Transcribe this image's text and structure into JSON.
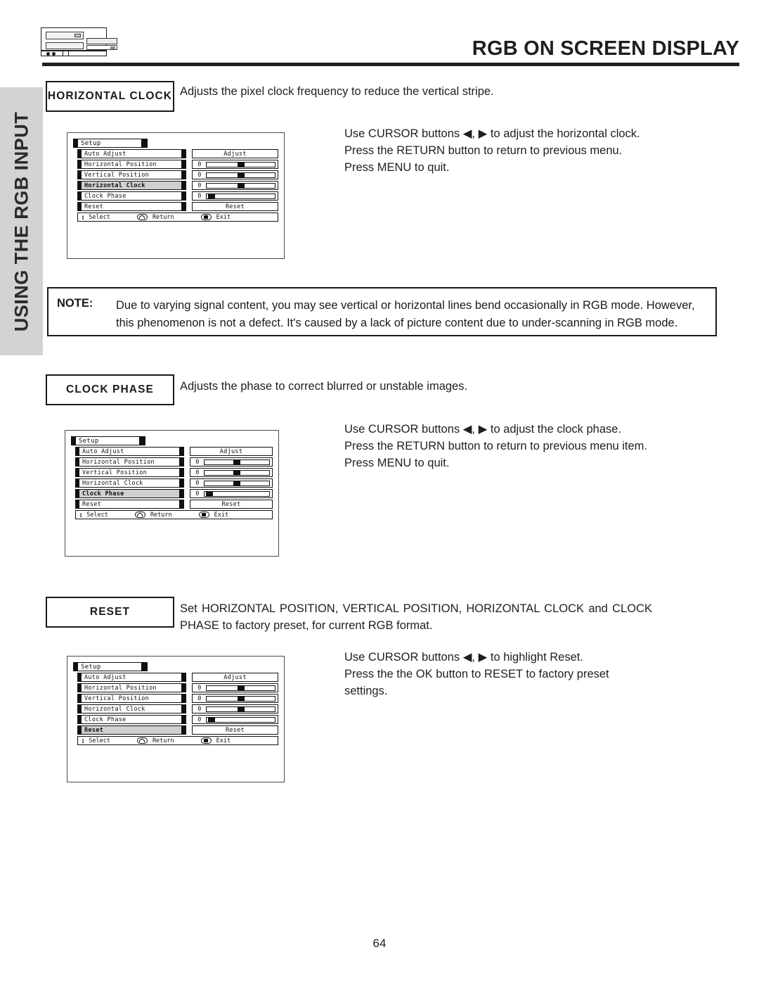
{
  "header": {
    "title": "RGB ON SCREEN DISPLAY",
    "logo_icon": "tv-equipment-icon"
  },
  "sidebar": {
    "label": "USING THE RGB INPUT"
  },
  "page": {
    "number": "64"
  },
  "note": {
    "label": "NOTE:",
    "text": "Due to varying signal content, you may see vertical or horizontal lines bend occasionally in RGB mode.  However, this phenomenon is not a defect.  It's caused by a lack of picture content due to under-scanning in RGB mode."
  },
  "sections": [
    {
      "label": "HORIZONTAL CLOCK",
      "description": "Adjusts the pixel clock frequency to reduce the vertical stripe.",
      "instructions": "Use CURSOR buttons ◀, ▶ to adjust the horizontal clock.\nPress the RETURN button to return to previous menu.\nPress MENU to quit.",
      "instruction_lines": [
        "Use CURSOR buttons ◀, ▶ to adjust the horizontal clock.",
        "Press the RETURN button to return to previous menu.",
        "Press MENU to quit."
      ]
    },
    {
      "label": "CLOCK PHASE",
      "description": "Adjusts the phase to correct blurred or unstable images.",
      "instruction_lines": [
        "Use CURSOR buttons ◀, ▶ to adjust the clock phase.",
        "Press the RETURN button to return to previous menu item.",
        "Press MENU to quit."
      ]
    },
    {
      "label": "RESET",
      "description": "Set HORIZONTAL POSITION, VERTICAL POSITION, HORIZONTAL CLOCK   and CLOCK PHASE to factory preset, for current RGB format.",
      "instruction_lines": [
        "Use CURSOR buttons ◀, ▶ to highlight Reset.",
        "Press the the OK button to RESET to factory preset",
        "settings."
      ]
    }
  ],
  "osd": {
    "title": "Setup",
    "footer": {
      "select_label": "Select",
      "return_label": "Return",
      "exit_label": "Exit",
      "select_icon": "up-down-arrow-icon",
      "return_icon": "return-key-icon",
      "exit_icon": "menu-key-icon"
    },
    "menus": [
      {
        "id": "horizontal-clock-menu",
        "selected": "Horizontal Clock",
        "rows": [
          {
            "name": "Auto Adjust",
            "type": "button",
            "value": "Adjust"
          },
          {
            "name": "Horizontal Position",
            "type": "slider",
            "value": "0",
            "percent": 50
          },
          {
            "name": "Vertical Position",
            "type": "slider",
            "value": "0",
            "percent": 50
          },
          {
            "name": "Horizontal Clock",
            "type": "slider",
            "value": "0",
            "percent": 50
          },
          {
            "name": "Clock Phase",
            "type": "slider",
            "value": "0",
            "percent": 2
          },
          {
            "name": "Reset",
            "type": "button",
            "value": "Reset"
          }
        ]
      },
      {
        "id": "clock-phase-menu",
        "selected": "Clock Phase",
        "rows": [
          {
            "name": "Auto Adjust",
            "type": "button",
            "value": "Adjust"
          },
          {
            "name": "Horizontal Position",
            "type": "slider",
            "value": "0",
            "percent": 50
          },
          {
            "name": "Vertical Position",
            "type": "slider",
            "value": "0",
            "percent": 50
          },
          {
            "name": "Horizontal Clock",
            "type": "slider",
            "value": "0",
            "percent": 50
          },
          {
            "name": "Clock Phase",
            "type": "slider",
            "value": "0",
            "percent": 2
          },
          {
            "name": "Reset",
            "type": "button",
            "value": "Reset"
          }
        ]
      },
      {
        "id": "reset-menu",
        "selected": "Reset",
        "rows": [
          {
            "name": "Auto Adjust",
            "type": "button",
            "value": "Adjust"
          },
          {
            "name": "Horizontal Position",
            "type": "slider",
            "value": "0",
            "percent": 50
          },
          {
            "name": "Vertical Position",
            "type": "slider",
            "value": "0",
            "percent": 50
          },
          {
            "name": "Horizontal Clock",
            "type": "slider",
            "value": "0",
            "percent": 50
          },
          {
            "name": "Clock Phase",
            "type": "slider",
            "value": "0",
            "percent": 2
          },
          {
            "name": "Reset",
            "type": "button",
            "value": "Reset"
          }
        ]
      }
    ]
  },
  "colors": {
    "rule": "#231f20",
    "sidebar_bg": "#d2d3d5",
    "highlight": "#cfcfcf",
    "text": "#1f1f1f"
  }
}
